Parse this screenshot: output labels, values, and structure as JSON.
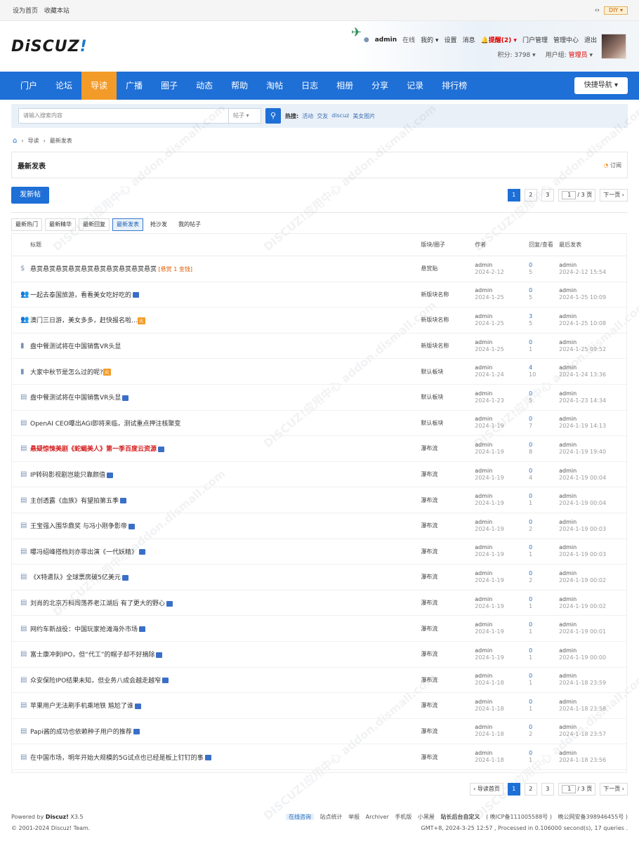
{
  "topbar": {
    "set_home": "设为首页",
    "bookmark": "收藏本站",
    "diy": "DIY"
  },
  "header": {
    "logo_text": "DiSCUZ",
    "logo_bang": "!",
    "user": {
      "name": "admin",
      "status": "在线",
      "mine": "我的",
      "settings": "设置",
      "messages": "消息",
      "remind": "提醒(2)",
      "portal_admin": "门户管理",
      "admin_center": "管理中心",
      "logout": "退出"
    },
    "points": "积分: 3798",
    "group_label": "用户组:",
    "group": "管理员"
  },
  "nav": {
    "items": [
      "门户",
      "论坛",
      "导读",
      "广播",
      "圈子",
      "动态",
      "帮助",
      "淘帖",
      "日志",
      "相册",
      "分享",
      "记录",
      "排行榜"
    ],
    "active_index": 2,
    "quicknav": "快捷导航"
  },
  "search": {
    "placeholder": "请输入搜索内容",
    "type": "帖子",
    "hot_label": "热搜:",
    "hot": [
      "活动",
      "交友",
      "discuz",
      "美女图片"
    ]
  },
  "breadcrumb": [
    "导读",
    "最新发表"
  ],
  "panel": {
    "title": "最新发表",
    "rss": "订阅"
  },
  "actions": {
    "new_thread": "发新帖",
    "pages": [
      "1",
      "2",
      "3"
    ],
    "page_input": "1",
    "total": "/ 3 页",
    "next": "下一页",
    "prev": "导读首页"
  },
  "tabs": [
    "最新热门",
    "最新精华",
    "最新回复",
    "最新发表",
    "抢沙发",
    "我的帖子"
  ],
  "table": {
    "headers": {
      "title": "标题",
      "forum": "版块/圈子",
      "author": "作者",
      "stat": "回复/查看",
      "last": "最后发表"
    },
    "rows": [
      {
        "icon": "$",
        "title": "悬赏悬赏悬赏悬赏悬赏悬赏悬赏悬赏悬赏悬赏",
        "bounty": " [悬赏 1 金钱]",
        "img": false,
        "hot": false,
        "red": false,
        "forum": "悬赏贴",
        "author": "admin",
        "date": "2024-2-12",
        "replies": "0",
        "views": "5",
        "last_author": "admin",
        "last_date": "2024-2-12 15:54"
      },
      {
        "icon": "👥",
        "title": "一起去泰国旅游，看看美女吃好吃的",
        "bounty": "",
        "img": true,
        "hot": false,
        "red": false,
        "forum": "新版块名称",
        "author": "admin",
        "date": "2024-1-25",
        "replies": "0",
        "views": "5",
        "last_author": "admin",
        "last_date": "2024-1-25 10:09"
      },
      {
        "icon": "👥",
        "title": "澳门三日游，美女多多，赶快报名啦...",
        "bounty": "",
        "img": false,
        "hot": true,
        "red": false,
        "forum": "新版块名称",
        "author": "admin",
        "date": "2024-1-25",
        "replies": "3",
        "views": "5",
        "last_author": "admin",
        "last_date": "2024-1-25 10:08"
      },
      {
        "icon": "▮",
        "title": "盘中餐测试将在中国销售VR头显",
        "bounty": "",
        "img": false,
        "hot": false,
        "red": false,
        "forum": "新版块名称",
        "author": "admin",
        "date": "2024-1-25",
        "replies": "0",
        "views": "1",
        "last_author": "admin",
        "last_date": "2024-1-25 09:52"
      },
      {
        "icon": "▮",
        "title": "大家中秋节是怎么过的呢?",
        "bounty": "",
        "img": false,
        "hot": true,
        "red": false,
        "forum": "默认板块",
        "author": "admin",
        "date": "2024-1-24",
        "replies": "4",
        "views": "10",
        "last_author": "admin",
        "last_date": "2024-1-24 13:36"
      },
      {
        "icon": "▤",
        "title": "盘中餐测试将在中国销售VR头显",
        "bounty": "",
        "img": true,
        "hot": false,
        "red": false,
        "forum": "默认板块",
        "author": "admin",
        "date": "2024-1-23",
        "replies": "0",
        "views": "5",
        "last_author": "admin",
        "last_date": "2024-1-23 14:34"
      },
      {
        "icon": "▤",
        "title": "OpenAI CEO曝出AGI即将来临，测试重点押注核聚变",
        "bounty": "",
        "img": false,
        "hot": false,
        "red": false,
        "forum": "默认板块",
        "author": "admin",
        "date": "2024-1-19",
        "replies": "0",
        "views": "7",
        "last_author": "admin",
        "last_date": "2024-1-19 14:13"
      },
      {
        "icon": "▤",
        "title": "悬疑惊悚美剧《蛇蝎美人》第一季百度云资源",
        "bounty": "",
        "img": true,
        "hot": false,
        "red": true,
        "forum": "瀑布流",
        "author": "admin",
        "date": "2024-1-19",
        "replies": "0",
        "views": "8",
        "last_author": "admin",
        "last_date": "2024-1-19 19:40"
      },
      {
        "icon": "▤",
        "title": "IP转码影视剧岂能只靠颜值",
        "bounty": "",
        "img": true,
        "hot": false,
        "red": false,
        "forum": "瀑布流",
        "author": "admin",
        "date": "2024-1-19",
        "replies": "0",
        "views": "4",
        "last_author": "admin",
        "last_date": "2024-1-19 00:04"
      },
      {
        "icon": "▤",
        "title": "主创透露《血族》有望拍第五季",
        "bounty": "",
        "img": true,
        "hot": false,
        "red": false,
        "forum": "瀑布流",
        "author": "admin",
        "date": "2024-1-19",
        "replies": "0",
        "views": "1",
        "last_author": "admin",
        "last_date": "2024-1-19 00:04"
      },
      {
        "icon": "▤",
        "title": "王宝强入围华鼎奖 与冯小刚争影帝",
        "bounty": "",
        "img": true,
        "hot": false,
        "red": false,
        "forum": "瀑布流",
        "author": "admin",
        "date": "2024-1-19",
        "replies": "0",
        "views": "2",
        "last_author": "admin",
        "last_date": "2024-1-19 00:03"
      },
      {
        "icon": "▤",
        "title": "曝冯绍峰搭档刘亦菲出演《一代妖精》",
        "bounty": "",
        "img": true,
        "hot": false,
        "red": false,
        "forum": "瀑布流",
        "author": "admin",
        "date": "2024-1-19",
        "replies": "0",
        "views": "1",
        "last_author": "admin",
        "last_date": "2024-1-19 00:03"
      },
      {
        "icon": "▤",
        "title": "《X特遣队》全球票房破5亿美元",
        "bounty": "",
        "img": true,
        "hot": false,
        "red": false,
        "forum": "瀑布流",
        "author": "admin",
        "date": "2024-1-19",
        "replies": "0",
        "views": "2",
        "last_author": "admin",
        "last_date": "2024-1-19 00:02"
      },
      {
        "icon": "▤",
        "title": "刘肖的北京万科闯荡养老江湖后 有了更大的野心",
        "bounty": "",
        "img": true,
        "hot": false,
        "red": false,
        "forum": "瀑布流",
        "author": "admin",
        "date": "2024-1-19",
        "replies": "0",
        "views": "1",
        "last_author": "admin",
        "last_date": "2024-1-19 00:02"
      },
      {
        "icon": "▤",
        "title": "网约车新战役：中国玩家抢滩海外市场",
        "bounty": "",
        "img": true,
        "hot": false,
        "red": false,
        "forum": "瀑布流",
        "author": "admin",
        "date": "2024-1-19",
        "replies": "0",
        "views": "1",
        "last_author": "admin",
        "last_date": "2024-1-19 00:01"
      },
      {
        "icon": "▤",
        "title": "富士康冲刺IPO，但“代工”的帽子却不好摘除",
        "bounty": "",
        "img": true,
        "hot": false,
        "red": false,
        "forum": "瀑布流",
        "author": "admin",
        "date": "2024-1-19",
        "replies": "0",
        "views": "1",
        "last_author": "admin",
        "last_date": "2024-1-19 00:00"
      },
      {
        "icon": "▤",
        "title": "众安保险IPO结果未知，但业务八成会越走越窄",
        "bounty": "",
        "img": true,
        "hot": false,
        "red": false,
        "forum": "瀑布流",
        "author": "admin",
        "date": "2024-1-18",
        "replies": "0",
        "views": "1",
        "last_author": "admin",
        "last_date": "2024-1-18 23:59"
      },
      {
        "icon": "▤",
        "title": "苹果用户无法刷手机乘地铁 尴尬了谁",
        "bounty": "",
        "img": true,
        "hot": false,
        "red": false,
        "forum": "瀑布流",
        "author": "admin",
        "date": "2024-1-18",
        "replies": "0",
        "views": "1",
        "last_author": "admin",
        "last_date": "2024-1-18 23:58"
      },
      {
        "icon": "▤",
        "title": "Papi酱的成功也依赖种子用户的推荐",
        "bounty": "",
        "img": true,
        "hot": false,
        "red": false,
        "forum": "瀑布流",
        "author": "admin",
        "date": "2024-1-18",
        "replies": "0",
        "views": "2",
        "last_author": "admin",
        "last_date": "2024-1-18 23:57"
      },
      {
        "icon": "▤",
        "title": "在中国市场，明年开始大规模的5G试点也已经是板上钉钉的事",
        "bounty": "",
        "img": true,
        "hot": false,
        "red": false,
        "forum": "瀑布流",
        "author": "admin",
        "date": "2024-1-18",
        "replies": "0",
        "views": "1",
        "last_author": "admin",
        "last_date": "2024-1-18 23:56"
      }
    ]
  },
  "footer": {
    "powered": "Powered by",
    "brand": "Discuz!",
    "version": "X3.5",
    "copyright": "© 2001-2024 Discuz! Team.",
    "online_consult": "在线咨询",
    "links": [
      "站点统计",
      "举报",
      "Archiver",
      "手机版",
      "小黑屋"
    ],
    "custom": "站长后台自定义",
    "icp": "( 晚ICP备111005588号 )",
    "police": "晚公网安备398946455号 )",
    "stats": "GMT+8, 2024-3-25 12:57 , Processed in 0.106000 second(s), 17 queries ."
  },
  "watermark": "DISCUZ!应用中心 addon.dismall.com"
}
